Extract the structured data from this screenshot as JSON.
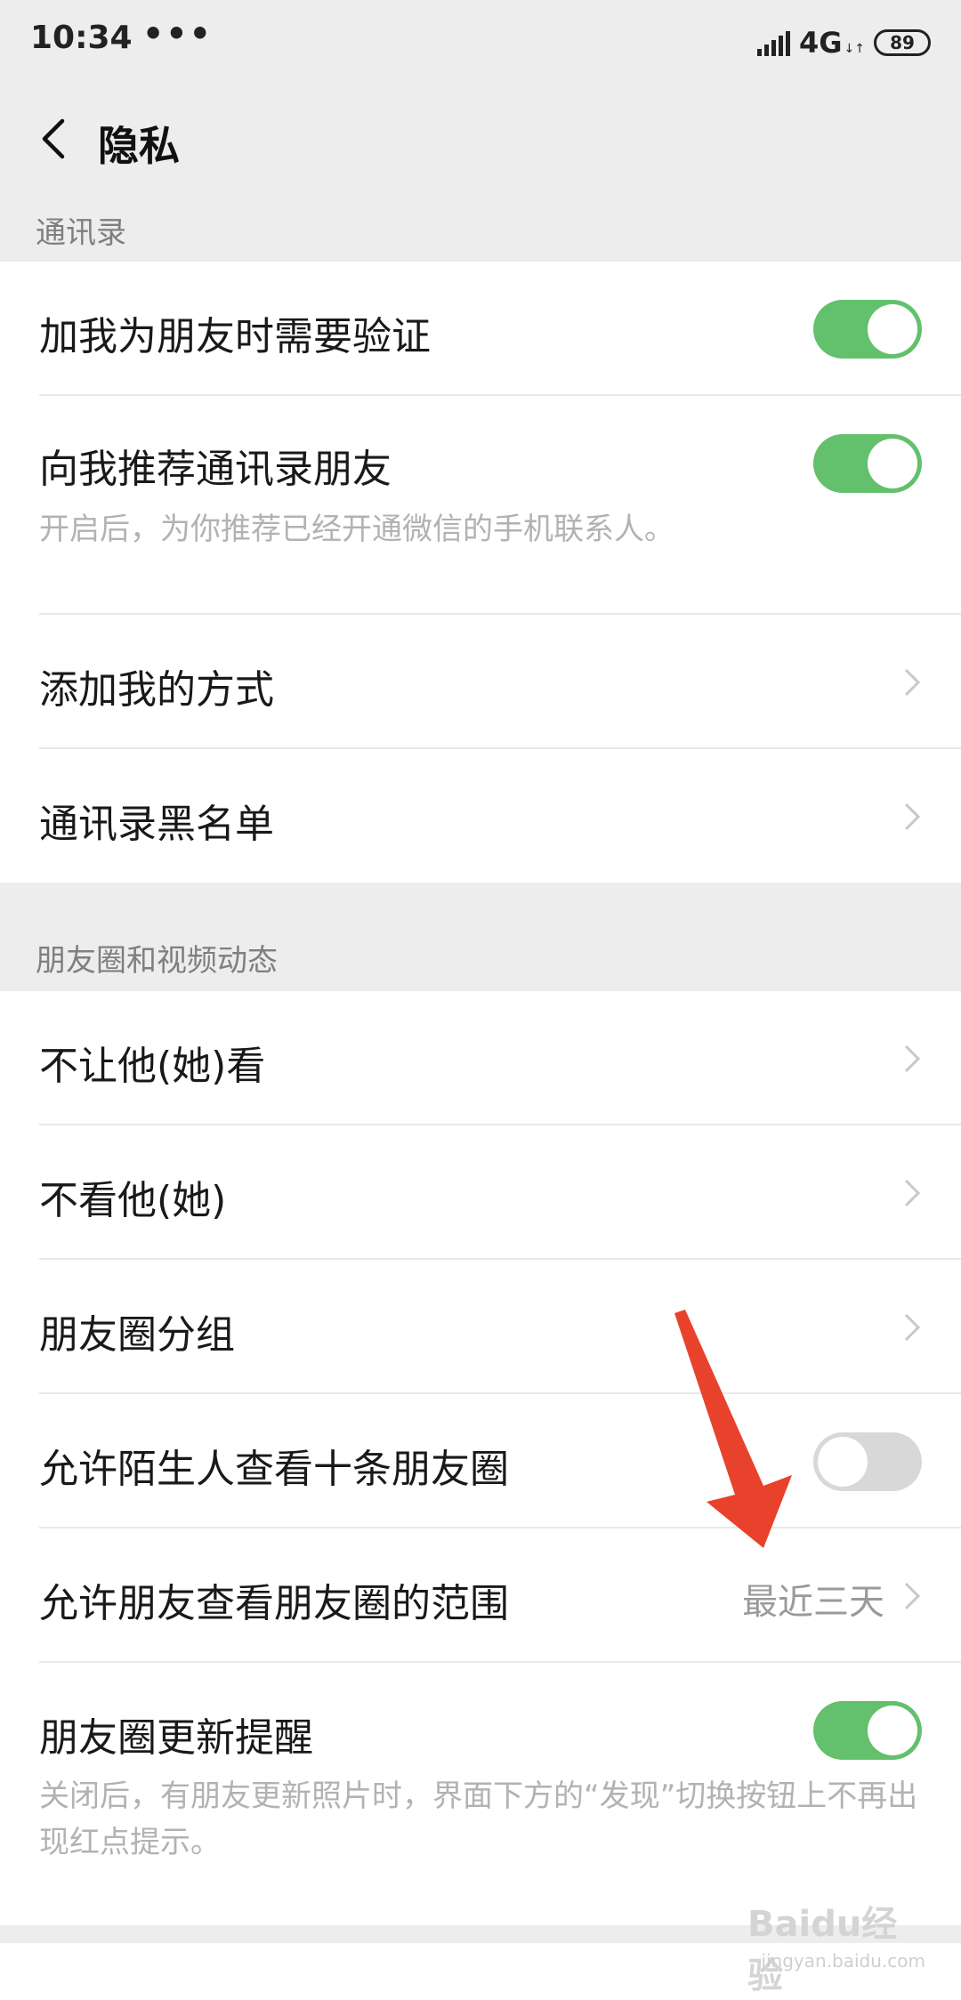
{
  "status_bar": {
    "time": "10:34",
    "dots": "•••",
    "network": "4G",
    "network_sub": "↓↑",
    "battery": "89"
  },
  "nav": {
    "back_icon": "chevron-left-icon",
    "title": "隐私"
  },
  "sections": {
    "contacts": {
      "header": "通讯录",
      "verify": {
        "label": "加我为朋友时需要验证",
        "enabled": true
      },
      "recommend": {
        "label": "向我推荐通讯录朋友",
        "desc": "开启后，为你推荐已经开通微信的手机联系人。",
        "enabled": true
      },
      "add_methods": {
        "label": "添加我的方式"
      },
      "blacklist": {
        "label": "通讯录黑名单"
      }
    },
    "moments": {
      "header": "朋友圈和视频动态",
      "hide_from": {
        "label": "不让他(她)看"
      },
      "dont_see": {
        "label": "不看他(她)"
      },
      "groups": {
        "label": "朋友圈分组"
      },
      "strangers": {
        "label": "允许陌生人查看十条朋友圈",
        "enabled": false
      },
      "range": {
        "label": "允许朋友查看朋友圈的范围",
        "value": "最近三天"
      },
      "update_reminder": {
        "label": "朋友圈更新提醒",
        "desc": "关闭后，有朋友更新照片时，界面下方的“发现”切换按钮上不再出现红点提示。",
        "enabled": true
      }
    }
  },
  "watermark": {
    "logo": "Baidu经验",
    "url": "jingyan.baidu.com"
  },
  "colors": {
    "toggle_on": "#63c06d",
    "toggle_off": "#d8d8d8",
    "arrow": "#e8412c"
  }
}
